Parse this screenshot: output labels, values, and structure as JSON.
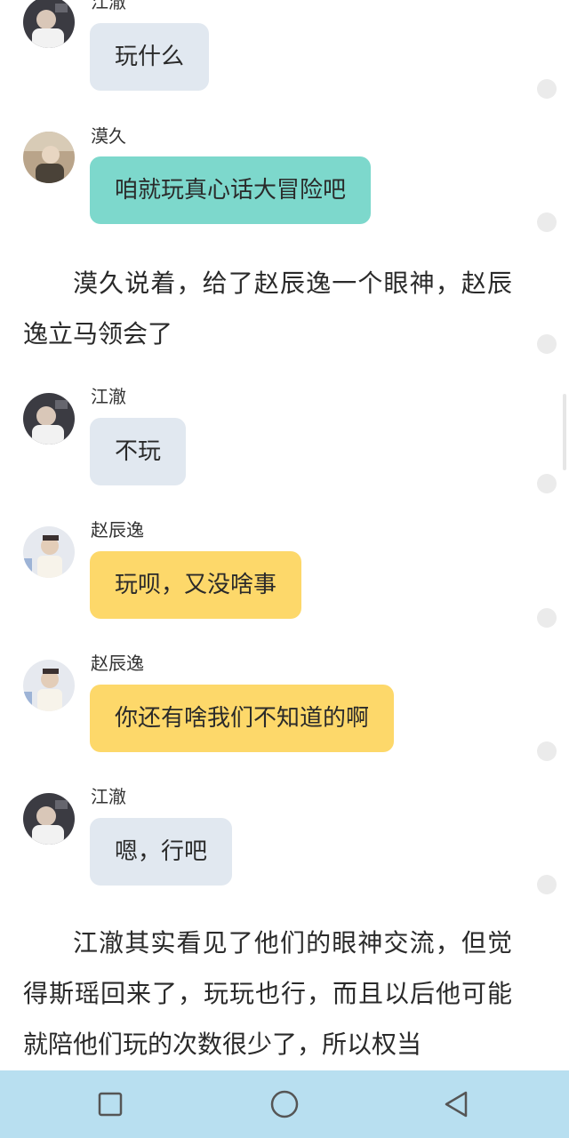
{
  "messages": [
    {
      "speaker": "江澈",
      "text": "玩什么",
      "color": "#e1e8f0"
    },
    {
      "speaker": "漠久",
      "text": "咱就玩真心话大冒险吧",
      "color": "#7dd8cc"
    },
    {
      "speaker": "江澈",
      "text": "不玩",
      "color": "#e1e8f0"
    },
    {
      "speaker": "赵辰逸",
      "text": "玩呗，又没啥事",
      "color": "#fdd86a"
    },
    {
      "speaker": "赵辰逸",
      "text": "你还有啥我们不知道的啊",
      "color": "#fdd86a"
    },
    {
      "speaker": "江澈",
      "text": "嗯，行吧",
      "color": "#e1e8f0"
    }
  ],
  "narration": [
    "漠久说着，给了赵辰逸一个眼神，赵辰逸立马领会了",
    "江澈其实看见了他们的眼神交流，但觉得斯瑶回来了，玩玩也行，而且以后他可能就陪他们玩的次数很少了，所以权当"
  ],
  "navbar": {
    "buttons": [
      "square-recents-icon",
      "circle-home-icon",
      "triangle-back-icon"
    ],
    "background": "#b8dff0"
  }
}
